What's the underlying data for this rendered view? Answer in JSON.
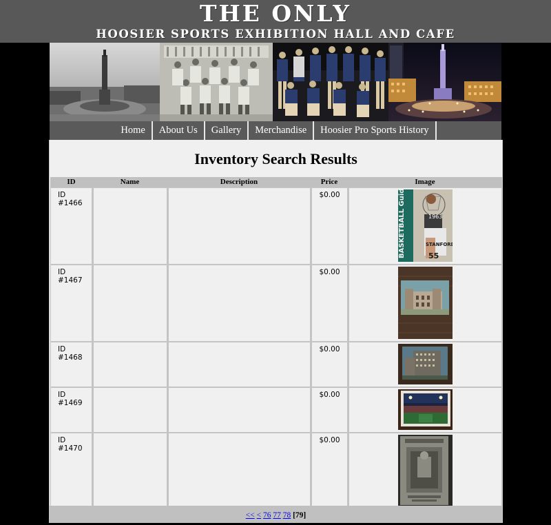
{
  "banner": {
    "title": "THE ONLY",
    "subtitle": "HOOSIER SPORTS EXHIBITION HALL AND CAFE"
  },
  "photos": [
    {
      "icon": "monument-photo"
    },
    {
      "icon": "vintage-team-photo"
    },
    {
      "icon": "basketball-team-photo"
    },
    {
      "icon": "night-monument-photo"
    }
  ],
  "nav": {
    "items": [
      {
        "label": "Home"
      },
      {
        "label": "About Us"
      },
      {
        "label": "Gallery"
      },
      {
        "label": "Merchandise"
      },
      {
        "label": "Hoosier Pro Sports History"
      }
    ]
  },
  "page": {
    "title": "Inventory Search Results"
  },
  "table": {
    "headers": {
      "id": "ID",
      "name": "Name",
      "description": "Description",
      "price": "Price",
      "image": "Image"
    },
    "rows": [
      {
        "id": "ID #1466",
        "name": "",
        "description": "",
        "price": "$0.00",
        "thumb": "basketball-guide-thumb",
        "thumb_text_1": "BASKETBALL Guide",
        "thumb_text_2": "1963",
        "thumb_text_3": "STANFORD",
        "thumb_text_4": "55"
      },
      {
        "id": "ID #1467",
        "name": "",
        "description": "",
        "price": "$0.00",
        "thumb": "building-postcard-thumb"
      },
      {
        "id": "ID #1468",
        "name": "",
        "description": "",
        "price": "$0.00",
        "thumb": "hotel-postcard-thumb"
      },
      {
        "id": "ID #1469",
        "name": "",
        "description": "",
        "price": "$0.00",
        "thumb": "stadium-photo-thumb"
      },
      {
        "id": "ID #1470",
        "name": "",
        "description": "",
        "price": "$0.00",
        "thumb": "program-cover-thumb"
      }
    ]
  },
  "pager": {
    "first": "<<",
    "prev": "<",
    "pages": [
      "76",
      "77",
      "78"
    ],
    "current": "[79]"
  }
}
